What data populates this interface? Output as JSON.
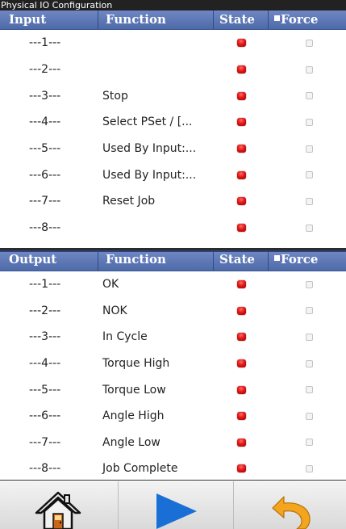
{
  "window": {
    "title": "Physical IO Configuration"
  },
  "input": {
    "headers": {
      "col1": "Input",
      "col2": "Function",
      "col3": "State",
      "col4": "Force"
    },
    "rows": [
      {
        "num": "---1---",
        "function": ""
      },
      {
        "num": "---2---",
        "function": ""
      },
      {
        "num": "---3---",
        "function": "Stop"
      },
      {
        "num": "---4---",
        "function": "Select PSet / [..."
      },
      {
        "num": "---5---",
        "function": "Used By Input:..."
      },
      {
        "num": "---6---",
        "function": "Used By Input:..."
      },
      {
        "num": "---7---",
        "function": "Reset Job"
      },
      {
        "num": "---8---",
        "function": ""
      }
    ]
  },
  "output": {
    "headers": {
      "col1": "Output",
      "col2": "Function",
      "col3": "State",
      "col4": "Force"
    },
    "rows": [
      {
        "num": "---1---",
        "function": "OK"
      },
      {
        "num": "---2---",
        "function": "NOK"
      },
      {
        "num": "---3---",
        "function": "In Cycle"
      },
      {
        "num": "---4---",
        "function": "Torque High"
      },
      {
        "num": "---5---",
        "function": "Torque Low"
      },
      {
        "num": "---6---",
        "function": "Angle High"
      },
      {
        "num": "---7---",
        "function": "Angle Low"
      },
      {
        "num": "---8---",
        "function": "Job Complete"
      }
    ]
  },
  "toolbar": {
    "buttons": [
      {
        "icon": "home-icon"
      },
      {
        "icon": "play-icon"
      },
      {
        "icon": "undo-icon"
      }
    ]
  },
  "colors": {
    "header": "#5a75b5",
    "state_led": "#e01818",
    "play": "#1a6fd6",
    "undo": "#f2a51d"
  }
}
